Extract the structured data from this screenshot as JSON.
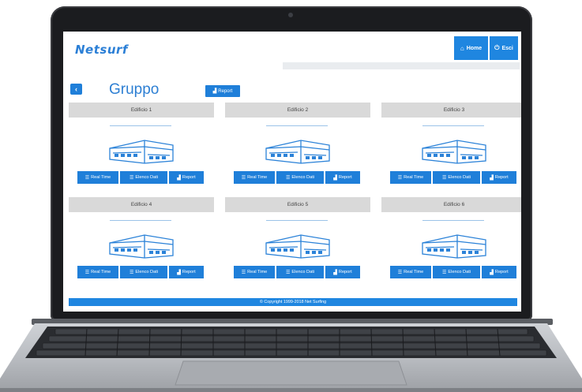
{
  "header": {
    "logo_text": "Netsurf",
    "home_label": "Home",
    "exit_label": "Esci"
  },
  "page": {
    "title": "Gruppo",
    "report_label": "Report"
  },
  "cards": [
    {
      "title": "Edificio 1"
    },
    {
      "title": "Edificio 2"
    },
    {
      "title": "Edificio 3"
    },
    {
      "title": "Edificio 4"
    },
    {
      "title": "Edificio 5"
    },
    {
      "title": "Edificio 6"
    }
  ],
  "card_buttons": {
    "realtime": "Real Time",
    "elenco": "Elenco Dati",
    "report": "Report"
  },
  "footer": {
    "text": "© Copyright 1999-2018 Net Surfing"
  },
  "colors": {
    "accent": "#1f7fd9",
    "card_header": "#d9d9d9",
    "title": "#2d7fd3"
  }
}
